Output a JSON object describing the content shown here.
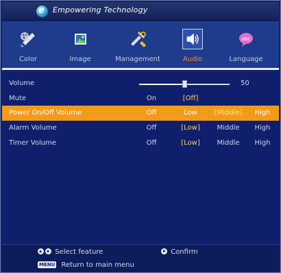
{
  "header": {
    "brand": "Empowering Technology",
    "logo_letter": "e"
  },
  "tabs": [
    {
      "label": "Color",
      "icon": "palette-icon",
      "active": false
    },
    {
      "label": "Image",
      "icon": "picture-icon",
      "active": false
    },
    {
      "label": "Management",
      "icon": "tools-icon",
      "active": false
    },
    {
      "label": "Audio",
      "icon": "speaker-icon",
      "active": true
    },
    {
      "label": "Language",
      "icon": "language-icon",
      "active": false
    }
  ],
  "rows": {
    "volume": {
      "label": "Volume",
      "value": "50",
      "level": 0.5
    },
    "mute": {
      "label": "Mute",
      "options": [
        "On",
        "[Off]"
      ]
    },
    "power": {
      "label": "Power On/Off Volume",
      "options": [
        "Off",
        "Low",
        "[Middle]",
        "High"
      ]
    },
    "alarm": {
      "label": "Alarm Volume",
      "options": [
        "Off",
        "[Low]",
        "Middle",
        "High"
      ]
    },
    "timer": {
      "label": "Timer Volume",
      "options": [
        "Off",
        "[Low]",
        "Middle",
        "High"
      ]
    }
  },
  "footer": {
    "select_hint": "Select feature",
    "confirm_hint": "Confirm",
    "menu_key": "MENU",
    "return_hint": "Return to main menu"
  },
  "colors": {
    "highlight": "#f29b1a",
    "active_tab": "#ff8c20",
    "background": "#0f1f6c"
  }
}
